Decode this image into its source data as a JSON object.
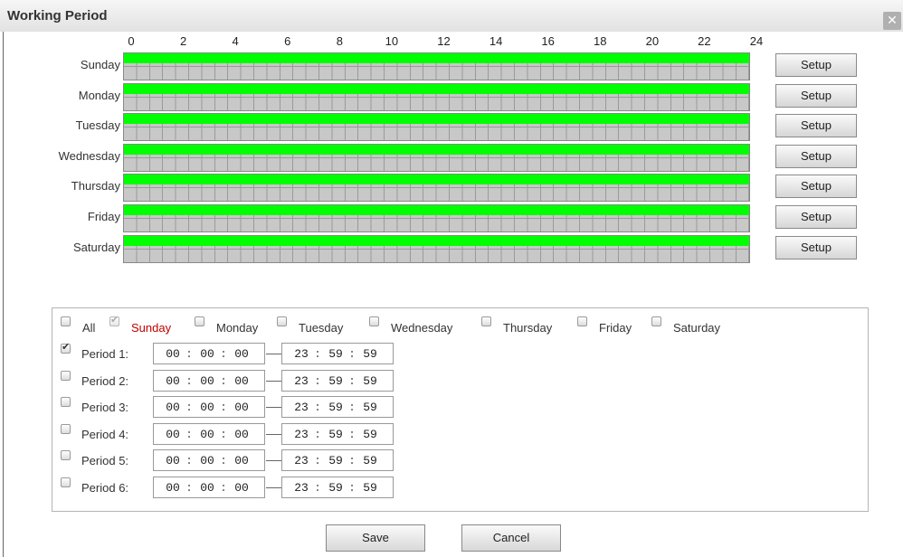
{
  "dialog": {
    "title": "Working Period",
    "close_glyph": "✕"
  },
  "hours": [
    "0",
    "2",
    "4",
    "6",
    "8",
    "10",
    "12",
    "14",
    "16",
    "18",
    "20",
    "22",
    "24"
  ],
  "days": [
    {
      "label": "Sunday",
      "bar_start_hour": 0,
      "bar_end_hour": 24,
      "setup_label": "Setup"
    },
    {
      "label": "Monday",
      "bar_start_hour": 0,
      "bar_end_hour": 24,
      "setup_label": "Setup"
    },
    {
      "label": "Tuesday",
      "bar_start_hour": 0,
      "bar_end_hour": 24,
      "setup_label": "Setup"
    },
    {
      "label": "Wednesday",
      "bar_start_hour": 0,
      "bar_end_hour": 24,
      "setup_label": "Setup"
    },
    {
      "label": "Thursday",
      "bar_start_hour": 0,
      "bar_end_hour": 24,
      "setup_label": "Setup"
    },
    {
      "label": "Friday",
      "bar_start_hour": 0,
      "bar_end_hour": 24,
      "setup_label": "Setup"
    },
    {
      "label": "Saturday",
      "bar_start_hour": 0,
      "bar_end_hour": 24,
      "setup_label": "Setup"
    }
  ],
  "day_selector": [
    {
      "label": "All",
      "checked": false,
      "disabled": false
    },
    {
      "label": "Sunday",
      "checked": true,
      "disabled": true,
      "highlight": true
    },
    {
      "label": "Monday",
      "checked": false,
      "disabled": false
    },
    {
      "label": "Tuesday",
      "checked": false,
      "disabled": false
    },
    {
      "label": "Wednesday",
      "checked": false,
      "disabled": false
    },
    {
      "label": "Thursday",
      "checked": false,
      "disabled": false
    },
    {
      "label": "Friday",
      "checked": false,
      "disabled": false
    },
    {
      "label": "Saturday",
      "checked": false,
      "disabled": false
    }
  ],
  "periods": [
    {
      "label": "Period 1:",
      "checked": true,
      "start": [
        "00",
        "00",
        "00"
      ],
      "end": [
        "23",
        "59",
        "59"
      ]
    },
    {
      "label": "Period 2:",
      "checked": false,
      "start": [
        "00",
        "00",
        "00"
      ],
      "end": [
        "23",
        "59",
        "59"
      ]
    },
    {
      "label": "Period 3:",
      "checked": false,
      "start": [
        "00",
        "00",
        "00"
      ],
      "end": [
        "23",
        "59",
        "59"
      ]
    },
    {
      "label": "Period 4:",
      "checked": false,
      "start": [
        "00",
        "00",
        "00"
      ],
      "end": [
        "23",
        "59",
        "59"
      ]
    },
    {
      "label": "Period 5:",
      "checked": false,
      "start": [
        "00",
        "00",
        "00"
      ],
      "end": [
        "23",
        "59",
        "59"
      ]
    },
    {
      "label": "Period 6:",
      "checked": false,
      "start": [
        "00",
        "00",
        "00"
      ],
      "end": [
        "23",
        "59",
        "59"
      ]
    }
  ],
  "time_separator": ":",
  "buttons": {
    "save": "Save",
    "cancel": "Cancel"
  },
  "colors": {
    "active_bar": "#00ff00",
    "highlight_day": "#c00000"
  }
}
